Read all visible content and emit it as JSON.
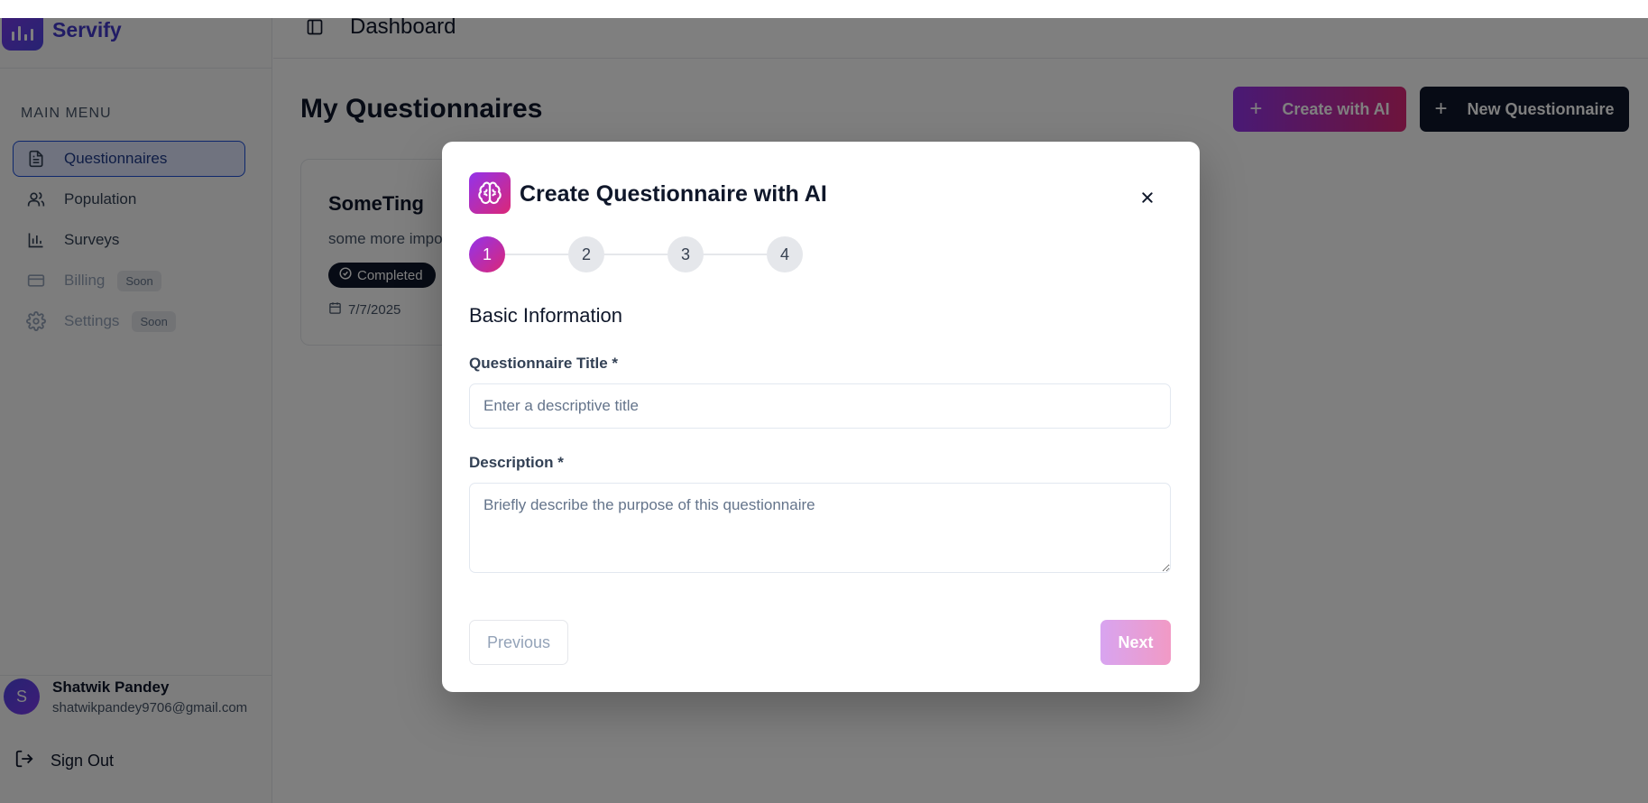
{
  "app": {
    "name": "Servify"
  },
  "sidebar": {
    "menu_title": "MAIN MENU",
    "items": [
      {
        "label": "Questionnaires",
        "icon": "document-icon",
        "active": true
      },
      {
        "label": "Population",
        "icon": "users-icon"
      },
      {
        "label": "Surveys",
        "icon": "bar-chart-icon"
      },
      {
        "label": "Billing",
        "icon": "credit-card-icon",
        "badge": "Soon",
        "disabled": true
      },
      {
        "label": "Settings",
        "icon": "gear-icon",
        "badge": "Soon",
        "disabled": true
      }
    ],
    "user": {
      "initial": "S",
      "name": "Shatwik Pandey",
      "email": "shatwikpandey9706@gmail.com"
    },
    "sign_out": "Sign Out"
  },
  "header": {
    "title": "Dashboard"
  },
  "main": {
    "title": "My Questionnaires",
    "create_ai_label": "Create with AI",
    "new_label": "New Questionnaire",
    "card": {
      "title": "SomeTing",
      "description": "some more impo",
      "status": "Completed",
      "date": "7/7/2025"
    }
  },
  "modal": {
    "title": "Create Questionnaire with AI",
    "steps": [
      "1",
      "2",
      "3",
      "4"
    ],
    "current_step": 1,
    "section_title": "Basic Information",
    "title_label": "Questionnaire Title *",
    "title_placeholder": "Enter a descriptive title",
    "title_value": "",
    "description_label": "Description *",
    "description_placeholder": "Briefly describe the purpose of this questionnaire",
    "description_value": "",
    "previous_label": "Previous",
    "next_label": "Next"
  },
  "colors": {
    "accent_gradient_start": "#9333ea",
    "accent_gradient_end": "#db2777",
    "brand": "#4338ca",
    "dark_button": "#0f172a"
  }
}
